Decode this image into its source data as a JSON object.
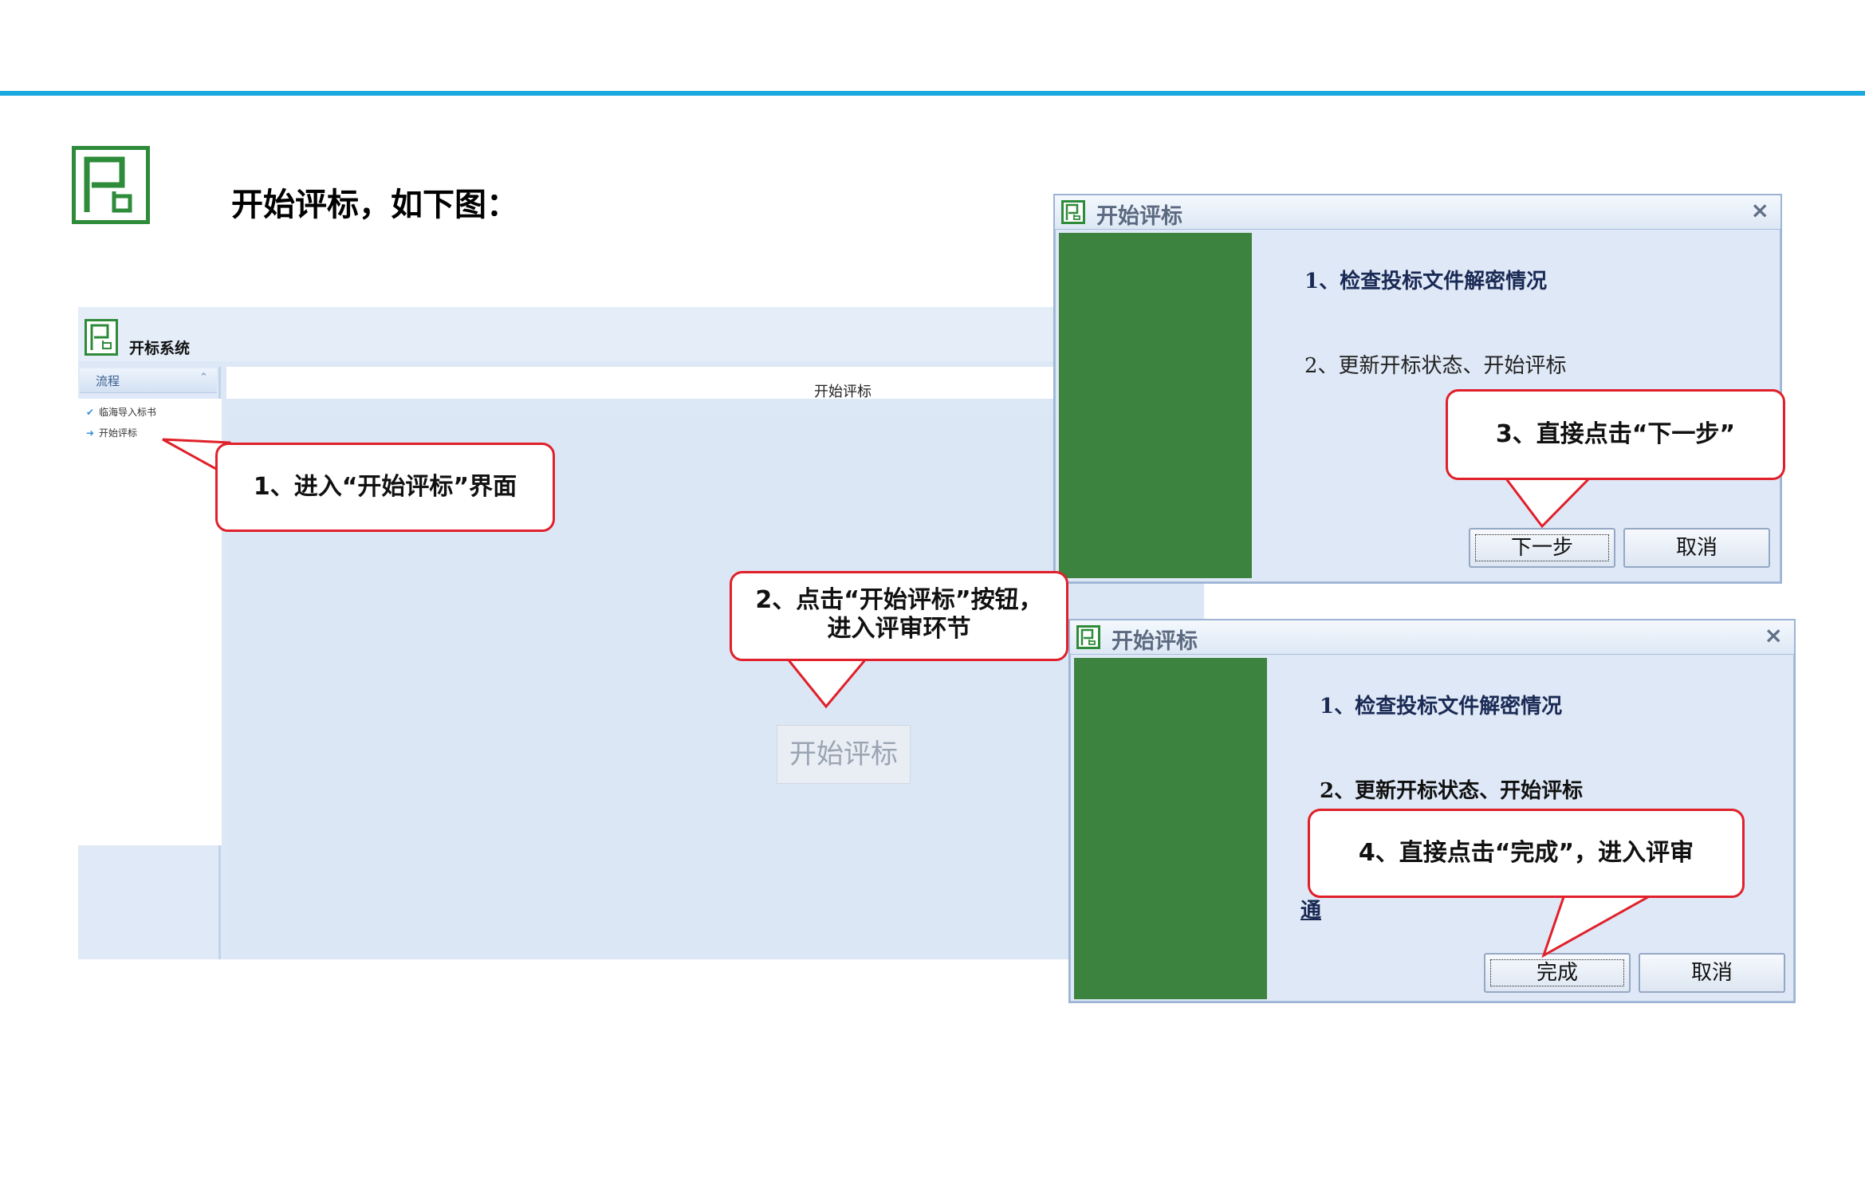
{
  "page": {
    "heading": "开始评标，如下图："
  },
  "app": {
    "title": "开标系统",
    "sidebar": {
      "header": "流程",
      "items": [
        {
          "icon": "check-icon",
          "label": "临海导入标书"
        },
        {
          "icon": "arrow-right-icon",
          "label": "开始评标"
        }
      ]
    },
    "main": {
      "header_title": "开始评标",
      "start_button": "开始评标"
    }
  },
  "dialog_1": {
    "title": "开始评标",
    "close": "×",
    "line_1": "1、检查投标文件解密情况",
    "line_2": "2、更新开标状态、开始评标",
    "next_button": "下一步",
    "cancel_button": "取消"
  },
  "dialog_2": {
    "title": "开始评标",
    "close": "×",
    "line_1": "1、检查投标文件解密情况",
    "line_2": "2、更新开标状态、开始评标",
    "partial_text": "通",
    "finish_button": "完成",
    "cancel_button": "取消"
  },
  "callouts": {
    "step_1": "1、进入“开始评标”界面",
    "step_2_line_1": "2、点击“开始评标”按钮，",
    "step_2_line_2": "进入评审环节",
    "step_3": "3、直接点击“下一步”",
    "step_4": "4、直接点击“完成”，进入评审"
  },
  "colors": {
    "accent_rule": "#19a9df",
    "logo_green": "#2e8b3a",
    "dialog_green": "#3c8340",
    "callout_red": "#e0202a",
    "app_background": "#dde8f6",
    "dialog_text_bold": "#1a2a55"
  }
}
